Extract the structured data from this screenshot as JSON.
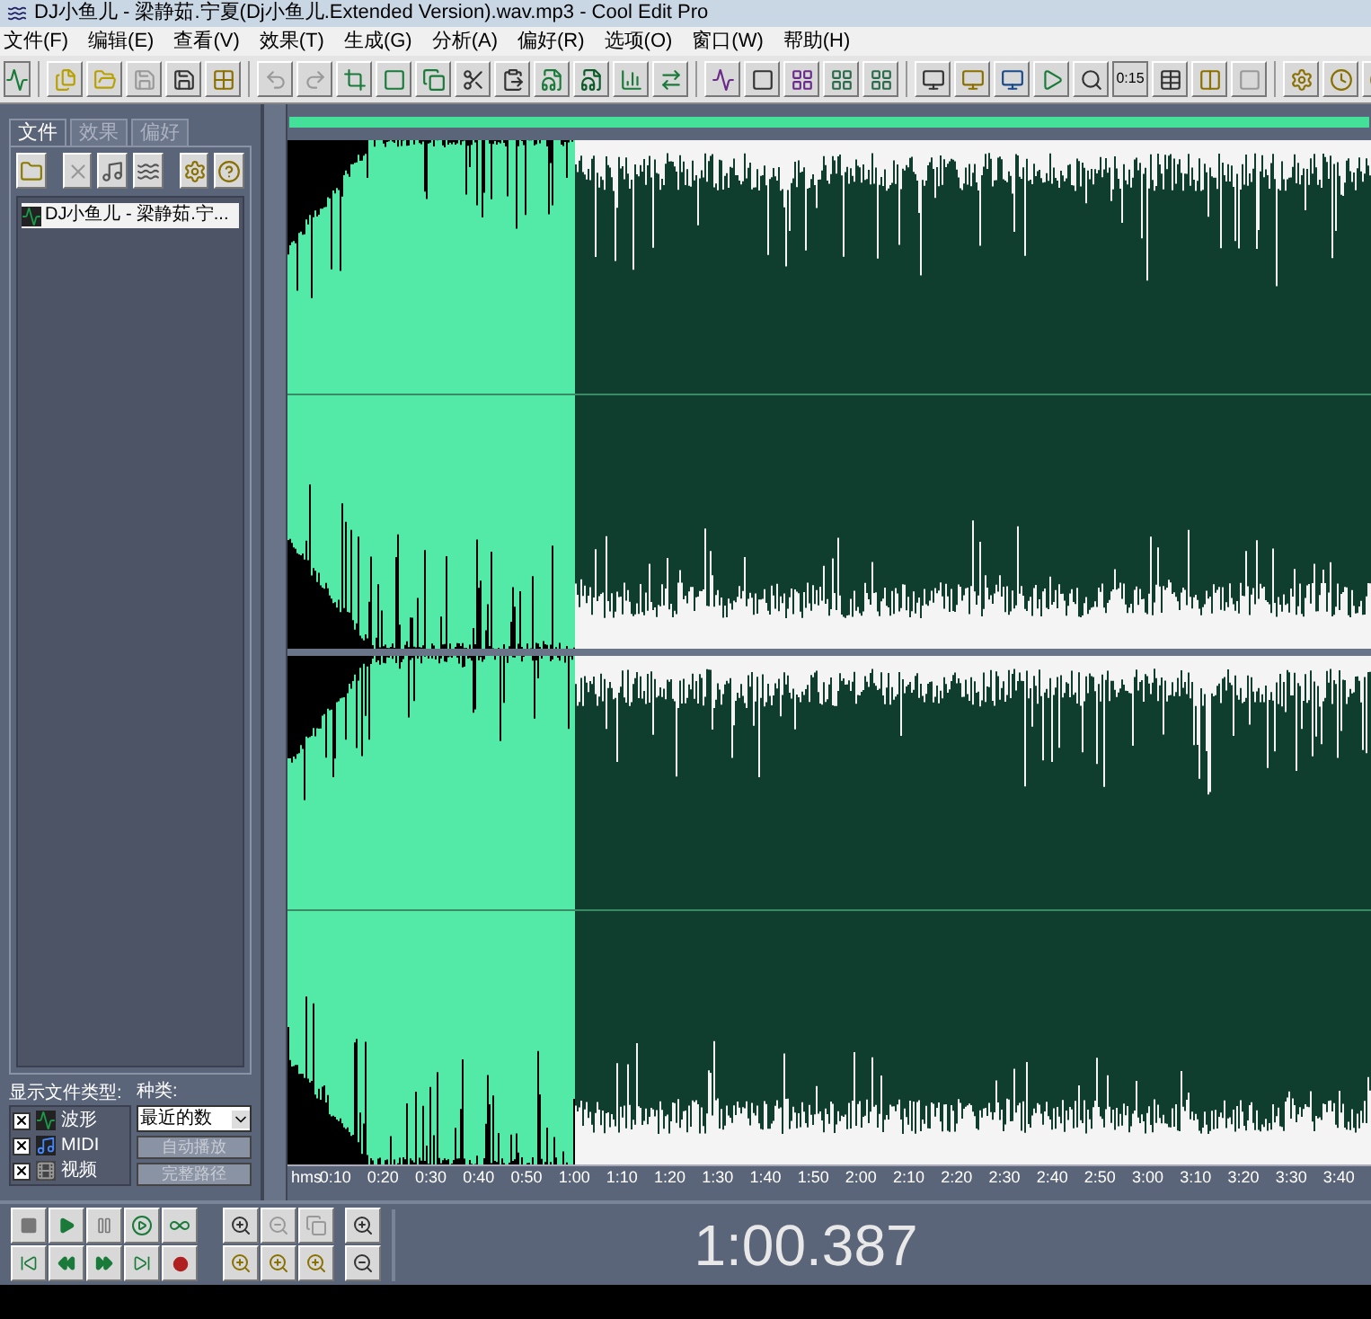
{
  "window": {
    "title": "DJ小鱼儿 - 梁静茹.宁夏(Dj小鱼儿.Extended Version).wav.mp3 - Cool Edit Pro"
  },
  "menu": [
    "文件(F)",
    "编辑(E)",
    "查看(V)",
    "效果(T)",
    "生成(G)",
    "分析(A)",
    "偏好(R)",
    "选项(O)",
    "窗口(W)",
    "帮助(H)"
  ],
  "toolbar": {
    "time_button": "0:15"
  },
  "left_panel": {
    "tabs": [
      {
        "label": "文件",
        "selected": true
      },
      {
        "label": "效果",
        "selected": false
      },
      {
        "label": "偏好",
        "selected": false
      }
    ],
    "files": [
      {
        "name": "DJ小鱼儿 - 梁静茹.宁...",
        "selected": true
      }
    ],
    "show_types_label": "显示文件类型:",
    "types": [
      {
        "label": "波形",
        "checked": true,
        "kind": "wave"
      },
      {
        "label": "MIDI",
        "checked": true,
        "kind": "midi"
      },
      {
        "label": "视频",
        "checked": true,
        "kind": "video"
      }
    ],
    "sort_label": "种类:",
    "sort_value": "最近的数",
    "buttons": [
      {
        "label": "自动播放",
        "disabled": true
      },
      {
        "label": "完整路径",
        "disabled": true
      }
    ]
  },
  "ruler": {
    "unit": "hms",
    "labels": [
      "0:10",
      "0:20",
      "0:30",
      "0:40",
      "0:50",
      "1:00",
      "1:10",
      "1:20",
      "1:30",
      "1:40",
      "1:50",
      "2:00",
      "2:10",
      "2:20",
      "2:30",
      "2:40",
      "2:50",
      "3:00",
      "3:10",
      "3:20",
      "3:30",
      "3:40"
    ]
  },
  "time_display": "1:00.387"
}
